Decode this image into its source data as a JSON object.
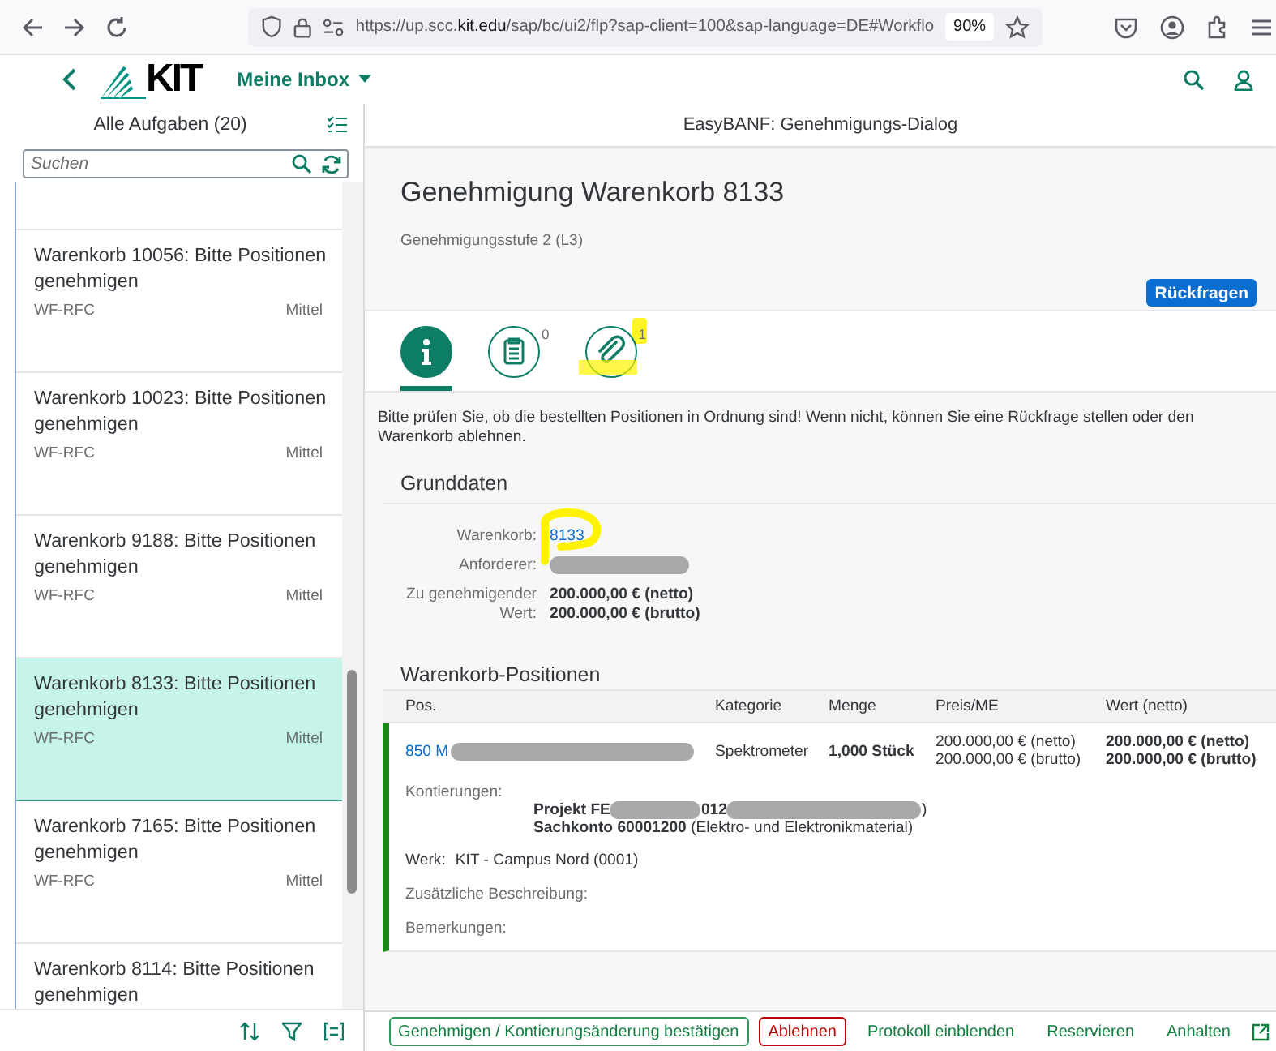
{
  "browser": {
    "url": "https://up.scc.**kit.edu**/sap/bc/ui2/flp?sap-client=100&sap-language=DE#Workflo",
    "zoom": "90%"
  },
  "shell": {
    "logo": "KIT",
    "title": "Meine Inbox"
  },
  "task_list": {
    "title": "Alle Aufgaben (20)",
    "search": {
      "placeholder": "Suchen"
    },
    "items": [
      {
        "title": "Warenkorb 10056: Bitte Positionen genehmigen",
        "source": "WF-RFC",
        "priority": "Mittel",
        "selected": false
      },
      {
        "title": "Warenkorb 10023: Bitte Positionen genehmigen",
        "source": "WF-RFC",
        "priority": "Mittel",
        "selected": false
      },
      {
        "title": "Warenkorb 9188: Bitte Positionen genehmigen",
        "source": "WF-RFC",
        "priority": "Mittel",
        "selected": false
      },
      {
        "title": "Warenkorb 8133: Bitte Positionen genehmigen",
        "source": "WF-RFC",
        "priority": "Mittel",
        "selected": true
      },
      {
        "title": "Warenkorb 7165: Bitte Positionen genehmigen",
        "source": "WF-RFC",
        "priority": "Mittel",
        "selected": false
      },
      {
        "title": "Warenkorb 8114: Bitte Positionen genehmigen",
        "selected": false
      }
    ]
  },
  "detail": {
    "page_title": "EasyBANF: Genehmigungs-Dialog",
    "heading": "Genehmigung Warenkorb 8133",
    "subheading": "Genehmigungsstufe 2 (L3)",
    "header_button": "Rückfragen",
    "tabs": [
      {
        "kind": "info",
        "selected": true
      },
      {
        "kind": "notes",
        "count": "0",
        "selected": false
      },
      {
        "kind": "attachments",
        "count": "1",
        "selected": false
      }
    ],
    "hint": "Bitte prüfen Sie, ob die bestellten Positionen in Ordnung sind! Wenn nicht, können Sie eine Rückfrage stellen oder den Warenkorb ablehnen.",
    "basic_data": {
      "title": "Grunddaten",
      "fields": [
        {
          "label": "Warenkorb:",
          "kind": "link",
          "value": "8133"
        },
        {
          "label": "Anforderer:",
          "kind": "redacted"
        },
        {
          "label": "Zu genehmigender Wert:",
          "kind": "amount",
          "lines": [
            "200.000,00 € (netto)",
            "200.000,00 € (brutto)"
          ]
        }
      ]
    },
    "positions": {
      "title": "Warenkorb-Positionen",
      "columns": [
        "Pos.",
        "Kategorie",
        "Menge",
        "Preis/ME",
        "Wert (netto)"
      ],
      "rows": [
        {
          "pos": "850 M",
          "category": "Spektrometer",
          "quantity": "1,000 Stück",
          "price": [
            "200.000,00 € (netto)",
            "200.000,00 € (brutto)"
          ],
          "value": [
            "200.000,00 € (netto)",
            "200.000,00 € (brutto)"
          ],
          "accounting_label": "Kontierungen:",
          "project_parts": [
            "Projekt FE",
            "012",
            ")"
          ],
          "account": "**Sachkonto 60001200** (Elektro- und Elektronikmaterial)",
          "plant_label": "Werk:",
          "plant": "KIT - Campus Nord (0001)",
          "extra_labels": [
            "Zusätzliche Beschreibung:",
            "Bemerkungen:"
          ]
        }
      ]
    }
  },
  "actions": [
    {
      "label": "Genehmigen / Kontierungsänderung bestätigen",
      "kind": "accept"
    },
    {
      "label": "Ablehnen",
      "kind": "reject"
    },
    {
      "label": "Protokoll einblenden",
      "kind": "text"
    },
    {
      "label": "Reservieren",
      "kind": "text"
    },
    {
      "label": "Anhalten",
      "kind": "text"
    }
  ]
}
